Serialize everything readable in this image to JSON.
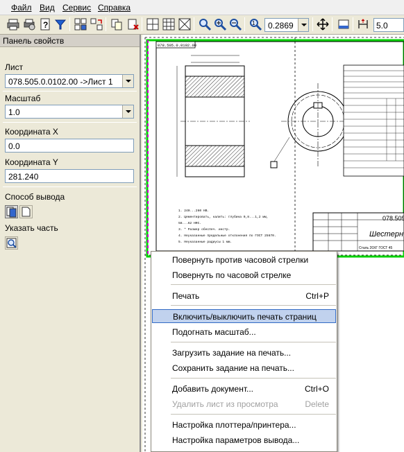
{
  "menubar": [
    "Файл",
    "Вид",
    "Сервис",
    "Справка"
  ],
  "toolbar": {
    "zoom_value": "0.2869",
    "step_value": "5.0"
  },
  "panel": {
    "title": "Панель свойств",
    "sheet_label": "Лист",
    "sheet_value": "078.505.0.0102.00 ->Лист 1",
    "scale_label": "Масштаб",
    "scale_value": "1.0",
    "x_label": "Координата X",
    "x_value": "0.0",
    "y_label": "Координата Y",
    "y_value": "281.240",
    "output_label": "Способ вывода",
    "part_label": "Указать часть"
  },
  "drawing": {
    "designation_rotated": "078.505.0.0102.00",
    "designation": "078.505",
    "title_block_name": "Шестерн",
    "title_block_material": "Сталь 20ХГ ГОСТ 45",
    "notes": [
      "1. 240...260 НВ.",
      "2. Цементировать, калить: глубина 0,8...1,2 мм,",
      "   58...62 HRC.",
      "3. * Размер обеспеч. инстр.",
      "4. Неуказанные предельные отклонения по ГОСТ 25670.",
      "5. Неуказанные радиусы 1 мм."
    ]
  },
  "context_menu": [
    {
      "label": "Повернуть против часовой стрелки",
      "shortcut": ""
    },
    {
      "label": "Повернуть по часовой стрелке",
      "shortcut": ""
    },
    {
      "label": "Печать",
      "shortcut": "Ctrl+P"
    },
    {
      "label": "Включить/выключить печать страниц",
      "shortcut": ""
    },
    {
      "label": "Подогнать масштаб...",
      "shortcut": ""
    },
    {
      "label": "Загрузить задание на печать...",
      "shortcut": ""
    },
    {
      "label": "Сохранить задание на печать...",
      "shortcut": ""
    },
    {
      "label": "Добавить документ...",
      "shortcut": "Ctrl+O"
    },
    {
      "label": "Удалить лист из просмотра",
      "shortcut": "Delete"
    },
    {
      "label": "Настройка плоттера/принтера...",
      "shortcut": ""
    },
    {
      "label": "Настройка параметров вывода...",
      "shortcut": ""
    }
  ],
  "colors": {
    "sheet_border": "#00d000",
    "selected_sheet": "#d000d0",
    "highlight": "#c1d2ee"
  }
}
